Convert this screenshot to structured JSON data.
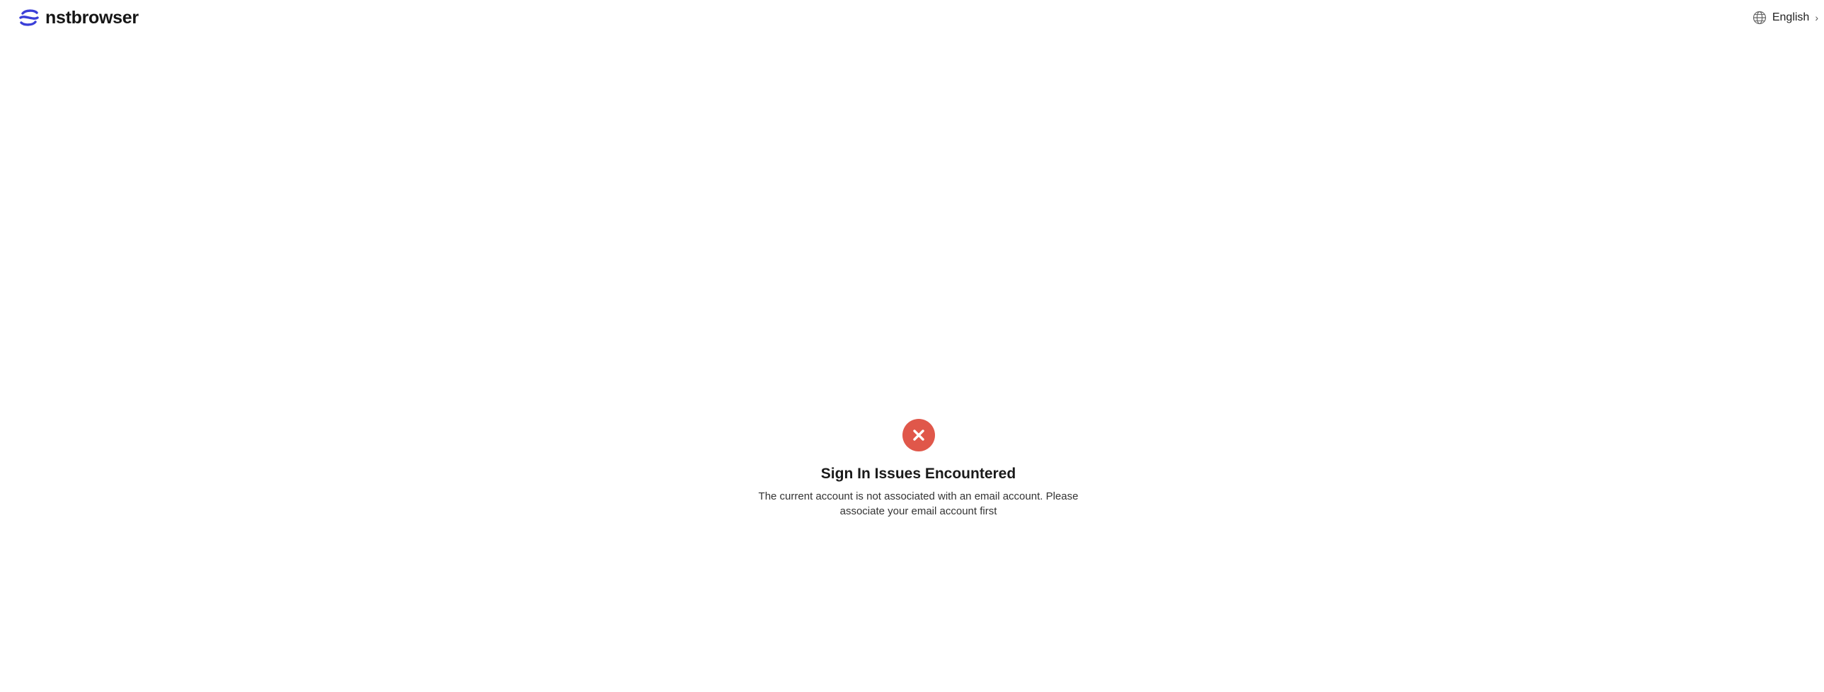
{
  "header": {
    "brand_name": "nstbrowser",
    "logo_icon": "nstbrowser-logo-icon",
    "language": {
      "icon": "globe-icon",
      "label": "English",
      "chevron": "›"
    }
  },
  "result": {
    "status_icon": "error-x-icon",
    "status_color": "#e0574a",
    "title": "Sign In Issues Encountered",
    "message": "The current account is not associated with an email account. Please associate your email account first"
  },
  "colors": {
    "accent": "#3b3fd8",
    "error": "#e0574a",
    "background": "#ffffff"
  }
}
